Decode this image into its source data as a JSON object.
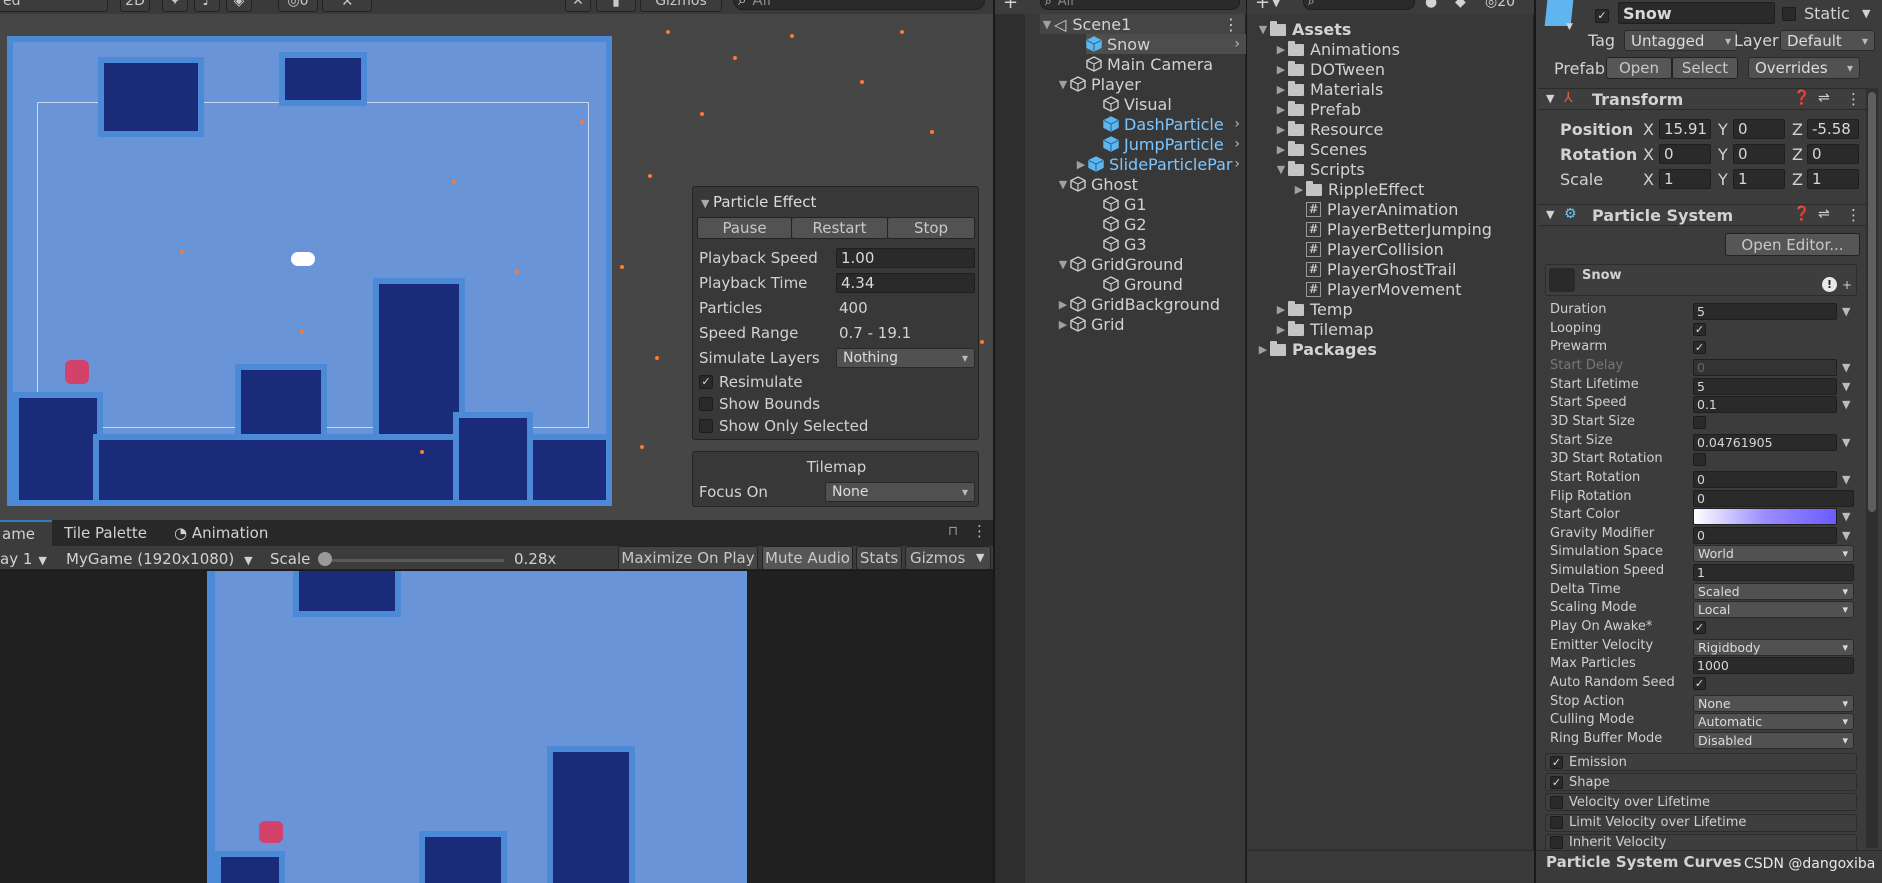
{
  "scene_toolbar": {
    "mode_label": "ed",
    "two_d": "2D",
    "gizmo_count": "0",
    "gizmos": "Gizmos",
    "search_placeholder": "All"
  },
  "particle_effect": {
    "title": "Particle Effect",
    "pause": "Pause",
    "restart": "Restart",
    "stop": "Stop",
    "rows": [
      {
        "label": "Playback Speed",
        "value": "1.00"
      },
      {
        "label": "Playback Time",
        "value": "4.34"
      },
      {
        "label": "Particles",
        "value": "400"
      },
      {
        "label": "Speed Range",
        "value": "0.7 - 19.1"
      },
      {
        "label": "Simulate Layers",
        "value": "Nothing"
      }
    ],
    "resimulate": "Resimulate",
    "show_bounds": "Show Bounds",
    "show_only_selected": "Show Only Selected"
  },
  "tilemap": {
    "title": "Tilemap",
    "focus_on_label": "Focus On",
    "focus_on_value": "None"
  },
  "bottom_tabs": {
    "game": "ame",
    "tile_palette": "Tile Palette",
    "animation": "Animation"
  },
  "game_toolbar": {
    "display": "ay 1",
    "resolution": "MyGame (1920x1080)",
    "scale_label": "Scale",
    "scale_value": "0.28x",
    "maximize": "Maximize On Play",
    "mute": "Mute Audio",
    "stats": "Stats",
    "gizmos": "Gizmos"
  },
  "hierarchy": {
    "search_placeholder": "All",
    "scene": "Scene1",
    "items": [
      {
        "label": "Snow",
        "blue": false,
        "selected": true
      },
      {
        "label": "Main Camera",
        "blue": false
      },
      {
        "label": "Player",
        "blue": false
      },
      {
        "label": "Visual",
        "blue": false
      },
      {
        "label": "DashParticle",
        "blue": true
      },
      {
        "label": "JumpParticle",
        "blue": true
      },
      {
        "label": "SlideParticlePar",
        "blue": true
      },
      {
        "label": "Ghost",
        "blue": false
      },
      {
        "label": "G1",
        "blue": false
      },
      {
        "label": "G2",
        "blue": false
      },
      {
        "label": "G3",
        "blue": false
      },
      {
        "label": "GridGround",
        "blue": false
      },
      {
        "label": "Ground",
        "blue": false
      },
      {
        "label": "GridBackground",
        "blue": false
      },
      {
        "label": "Grid",
        "blue": false
      }
    ]
  },
  "project": {
    "root": "Assets",
    "folders": [
      "Animations",
      "DOTween",
      "Materials",
      "Prefab",
      "Resource",
      "Scenes",
      "Scripts"
    ],
    "scripts": [
      "RippleEffect",
      "PlayerAnimation",
      "PlayerBetterJumping",
      "PlayerCollision",
      "PlayerGhostTrail",
      "PlayerMovement"
    ],
    "after": [
      "Temp",
      "Tilemap"
    ],
    "packages": "Packages",
    "count": "20"
  },
  "inspector": {
    "name": "Snow",
    "static": "Static",
    "tag_label": "Tag",
    "tag": "Untagged",
    "layer_label": "Layer",
    "layer": "Default",
    "prefab_label": "Prefab",
    "open": "Open",
    "select": "Select",
    "overrides": "Overrides",
    "transform_title": "Transform",
    "position_label": "Position",
    "rotation_label": "Rotation",
    "scale_label": "Scale",
    "position": {
      "x": "15.91",
      "y": "0",
      "z": "-5.58"
    },
    "rotation": {
      "x": "0",
      "y": "0",
      "z": "0"
    },
    "scale": {
      "x": "1",
      "y": "1",
      "z": "1"
    },
    "ps_title": "Particle System",
    "open_editor": "Open Editor...",
    "ps_name": "Snow",
    "ps_fields": [
      {
        "label": "Duration",
        "value": "5",
        "kind": "field"
      },
      {
        "label": "Looping",
        "value": "✓",
        "kind": "check"
      },
      {
        "label": "Prewarm",
        "value": "✓",
        "kind": "check"
      },
      {
        "label": "Start Delay",
        "value": "0",
        "kind": "disabled"
      },
      {
        "label": "Start Lifetime",
        "value": "5",
        "kind": "field"
      },
      {
        "label": "Start Speed",
        "value": "0.1",
        "kind": "field"
      },
      {
        "label": "3D Start Size",
        "value": "",
        "kind": "check"
      },
      {
        "label": "Start Size",
        "value": "0.04761905",
        "kind": "field"
      },
      {
        "label": "3D Start Rotation",
        "value": "",
        "kind": "check"
      },
      {
        "label": "Start Rotation",
        "value": "0",
        "kind": "field"
      },
      {
        "label": "Flip Rotation",
        "value": "0",
        "kind": "wide"
      },
      {
        "label": "Start Color",
        "value": "",
        "kind": "color"
      },
      {
        "label": "Gravity Modifier",
        "value": "0",
        "kind": "field"
      },
      {
        "label": "Simulation Space",
        "value": "World",
        "kind": "dropdown"
      },
      {
        "label": "Simulation Speed",
        "value": "1",
        "kind": "wide"
      },
      {
        "label": "Delta Time",
        "value": "Scaled",
        "kind": "dropdown"
      },
      {
        "label": "Scaling Mode",
        "value": "Local",
        "kind": "dropdown"
      },
      {
        "label": "Play On Awake*",
        "value": "✓",
        "kind": "check"
      },
      {
        "label": "Emitter Velocity",
        "value": "Rigidbody",
        "kind": "dropdown"
      },
      {
        "label": "Max Particles",
        "value": "1000",
        "kind": "wide"
      },
      {
        "label": "Auto Random Seed",
        "value": "✓",
        "kind": "check"
      },
      {
        "label": "Stop Action",
        "value": "None",
        "kind": "dropdown"
      },
      {
        "label": "Culling Mode",
        "value": "Automatic",
        "kind": "dropdown"
      },
      {
        "label": "Ring Buffer Mode",
        "value": "Disabled",
        "kind": "dropdown"
      }
    ],
    "modules": [
      {
        "label": "Emission",
        "checked": "✓"
      },
      {
        "label": "Shape",
        "checked": "✓"
      },
      {
        "label": "Velocity over Lifetime",
        "checked": ""
      },
      {
        "label": "Limit Velocity over Lifetime",
        "checked": ""
      },
      {
        "label": "Inherit Velocity",
        "checked": ""
      }
    ],
    "curves_title": "Particle System Curves",
    "watermark": "CSDN @dangoxiba"
  },
  "colors": {
    "panel": "#383838",
    "dark": "#282828",
    "selection": "#2c5d87",
    "sky": "#6a94d8",
    "tile_dark": "#1a2b7a",
    "tile_edge": "#4c8ad8",
    "spark": "#ff7a2a"
  }
}
